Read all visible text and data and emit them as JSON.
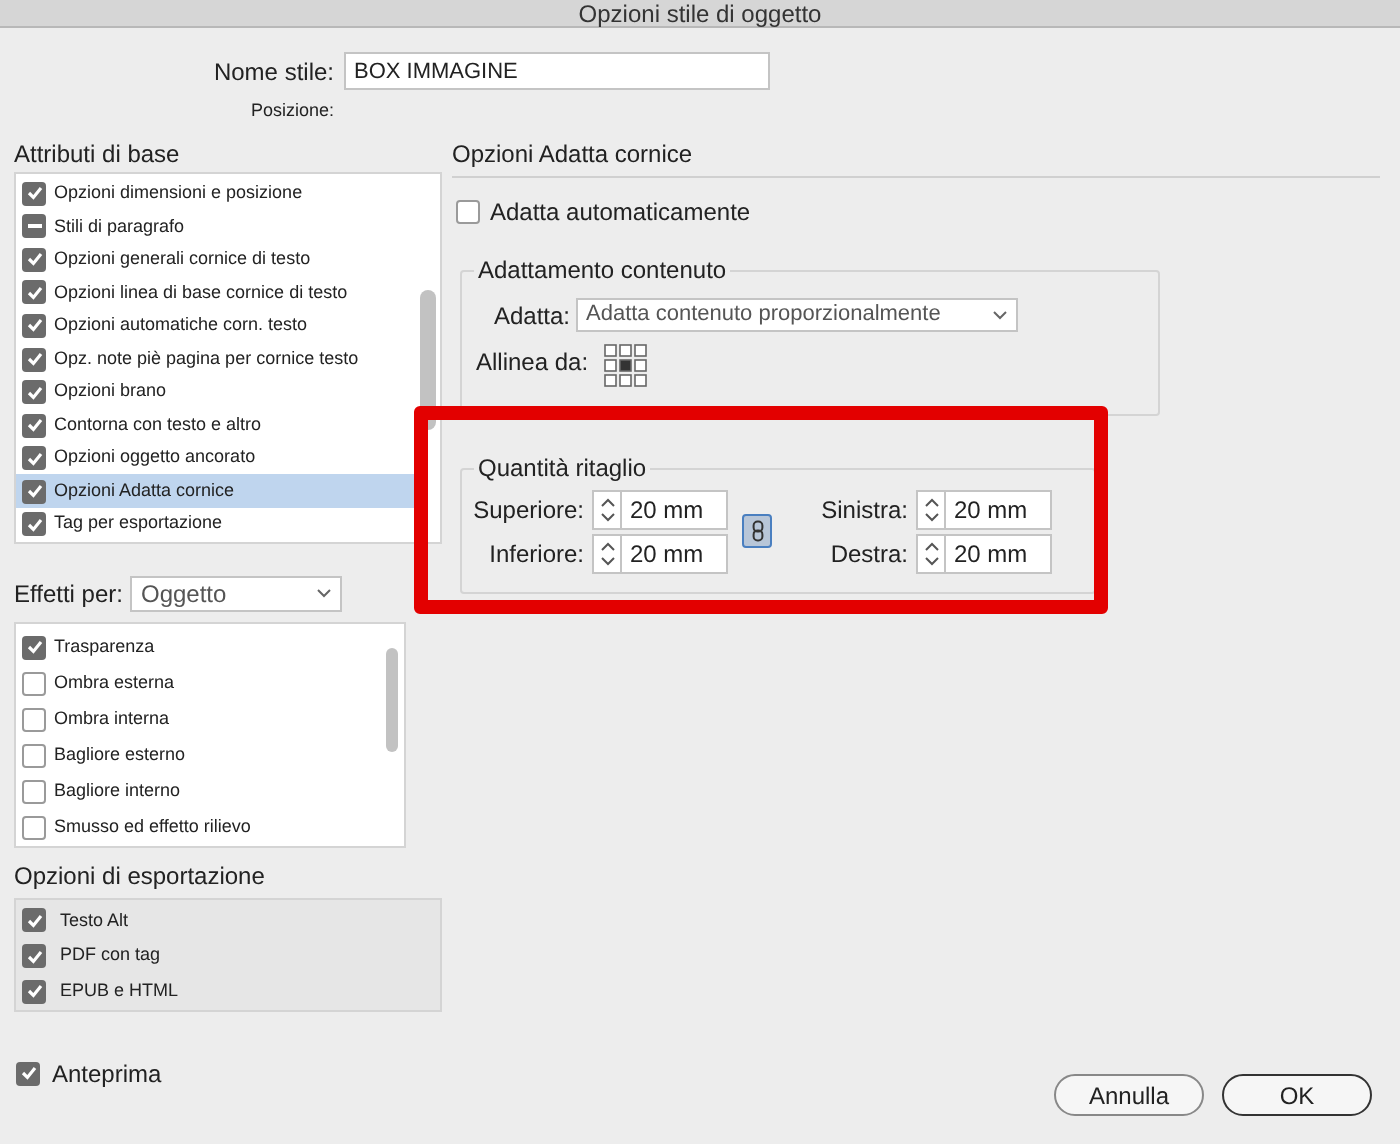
{
  "window": {
    "title": "Opzioni stile di oggetto"
  },
  "style_name": {
    "label": "Nome stile:",
    "value": "BOX IMMAGINE"
  },
  "position": {
    "label": "Posizione:"
  },
  "basic_attributes": {
    "title": "Attributi di base",
    "items": [
      {
        "label": "Opzioni dimensioni e posizione",
        "kind": "tick",
        "checked": true,
        "selected": false
      },
      {
        "label": "Stili di paragrafo",
        "kind": "partial",
        "checked": true,
        "selected": false
      },
      {
        "label": "Opzioni generali cornice di testo",
        "kind": "tick",
        "checked": true,
        "selected": false
      },
      {
        "label": "Opzioni linea di base cornice di testo",
        "kind": "tick",
        "checked": true,
        "selected": false
      },
      {
        "label": "Opzioni automatiche corn. testo",
        "kind": "tick",
        "checked": true,
        "selected": false
      },
      {
        "label": "Opz. note piè pagina per cornice testo",
        "kind": "tick",
        "checked": true,
        "selected": false
      },
      {
        "label": "Opzioni brano",
        "kind": "tick",
        "checked": true,
        "selected": false
      },
      {
        "label": "Contorna con testo e altro",
        "kind": "tick",
        "checked": true,
        "selected": false
      },
      {
        "label": "Opzioni oggetto ancorato",
        "kind": "tick",
        "checked": true,
        "selected": false
      },
      {
        "label": "Opzioni Adatta cornice",
        "kind": "tick",
        "checked": true,
        "selected": true
      },
      {
        "label": "Tag per esportazione",
        "kind": "tick",
        "checked": true,
        "selected": false
      }
    ]
  },
  "effects_for": {
    "label": "Effetti per:",
    "value": "Oggetto"
  },
  "effects": [
    {
      "label": "Trasparenza",
      "checked": true
    },
    {
      "label": "Ombra esterna",
      "checked": false
    },
    {
      "label": "Ombra interna",
      "checked": false
    },
    {
      "label": "Bagliore esterno",
      "checked": false
    },
    {
      "label": "Bagliore interno",
      "checked": false
    },
    {
      "label": "Smusso ed effetto rilievo",
      "checked": false
    }
  ],
  "export_options": {
    "title": "Opzioni di esportazione",
    "items": [
      {
        "label": "Testo Alt",
        "checked": true
      },
      {
        "label": "PDF con tag",
        "checked": true
      },
      {
        "label": "EPUB e HTML",
        "checked": true
      }
    ]
  },
  "preview": {
    "label": "Anteprima",
    "checked": true
  },
  "panel": {
    "title": "Opzioni Adatta cornice",
    "auto_fit": {
      "label": "Adatta automaticamente",
      "checked": false
    },
    "content_fitting": {
      "title": "Adattamento contenuto",
      "fit_label": "Adatta:",
      "fit_value": "Adatta contenuto proporzionalmente",
      "align_label": "Allinea da:"
    },
    "crop": {
      "title": "Quantità ritaglio",
      "link_on": true,
      "fields": [
        {
          "label": "Superiore:",
          "value": "20 mm"
        },
        {
          "label": "Sinistra:",
          "value": "20 mm"
        },
        {
          "label": "Inferiore:",
          "value": "20 mm"
        },
        {
          "label": "Destra:",
          "value": "20 mm"
        }
      ]
    }
  },
  "buttons": [
    {
      "label": "Annulla",
      "kind": "cancel"
    },
    {
      "label": "OK",
      "kind": "default"
    }
  ]
}
